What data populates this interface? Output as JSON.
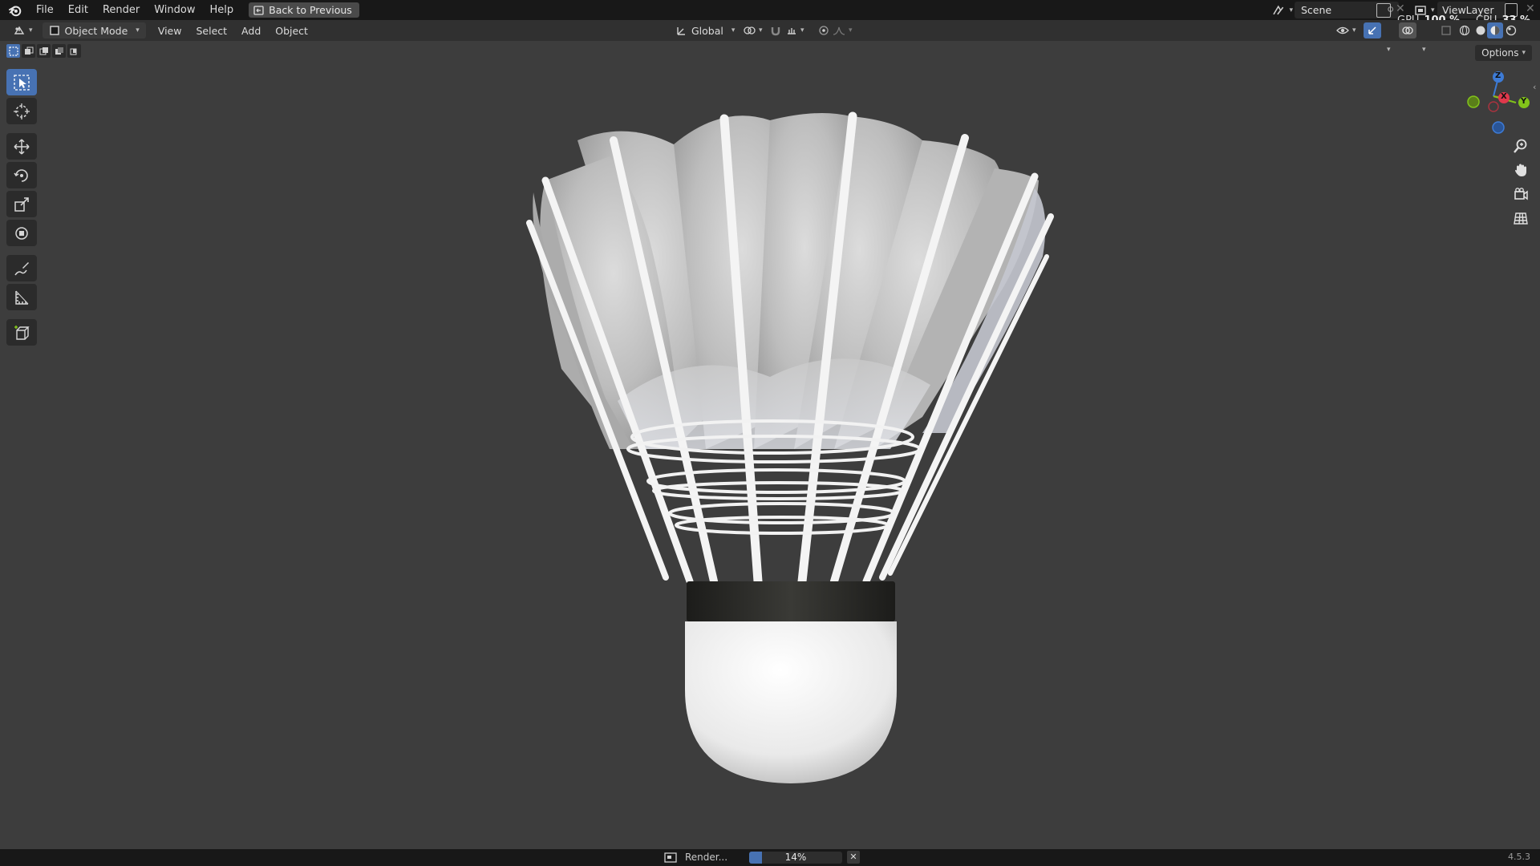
{
  "app": {
    "name": "Blender",
    "version": "4.5.3"
  },
  "menu": {
    "items": [
      "File",
      "Edit",
      "Render",
      "Window",
      "Help"
    ],
    "back_button": "Back to Previous"
  },
  "topright": {
    "scene": "Scene",
    "view_layer": "ViewLayer",
    "gpu_label": "GPU",
    "gpu_value": "100 %",
    "cpu_label": "CPU",
    "cpu_value": "33 %"
  },
  "header": {
    "mode": "Object Mode",
    "menus": [
      "View",
      "Select",
      "Add",
      "Object"
    ],
    "transform_orientation": "Global"
  },
  "viewport": {
    "options_label": "Options",
    "gizmo_axes": {
      "z": "Z",
      "x": "X",
      "y": "Y"
    }
  },
  "toolbar": {
    "tools": [
      "select-box",
      "cursor",
      "move",
      "rotate",
      "scale",
      "transform",
      "annotate",
      "measure",
      "add-cube"
    ],
    "active": "select-box"
  },
  "status": {
    "job_label": "Render...",
    "progress_text": "14%",
    "progress_value": 0.14,
    "version": "4.5.3"
  },
  "colors": {
    "accent": "#4772b3",
    "axis_x": "#e0384c",
    "axis_y": "#82c31a",
    "axis_z": "#3d7bd6"
  }
}
